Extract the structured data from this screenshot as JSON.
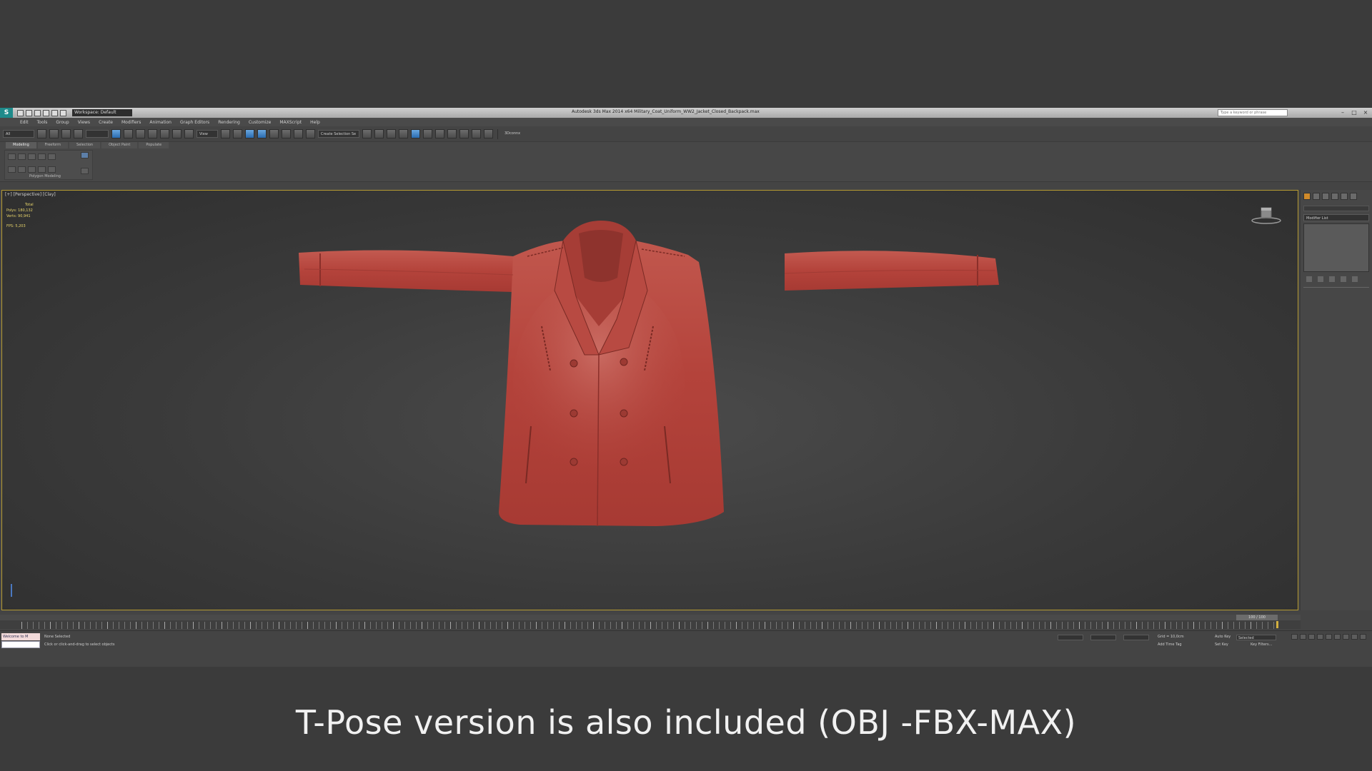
{
  "app": {
    "title": "Autodesk 3ds Max 2014 x64    Military_Coat_Uniform_WW2_Jacket_Closed_Backpack.max",
    "workspace": "Workspace: Default",
    "search_placeholder": "Type a keyword or phrase"
  },
  "menu": [
    "Edit",
    "Tools",
    "Group",
    "Views",
    "Create",
    "Modifiers",
    "Animation",
    "Graph Editors",
    "Rendering",
    "Customize",
    "MAXScript",
    "Help"
  ],
  "toolbar": {
    "selection_filter": "All",
    "view_dd": "View",
    "named_selection": "Create Selection Se",
    "extra_label": "3Dconnx"
  },
  "ribbon": {
    "tabs": [
      "Modeling",
      "Freeform",
      "Selection",
      "Object Paint",
      "Populate"
    ],
    "panel_label": "Polygon Modeling"
  },
  "viewport": {
    "label": "[+] [Perspective] [Clay]",
    "stats_header": "Total",
    "polys_label": "Polys:",
    "polys_value": "180,132",
    "verts_label": "Verts:",
    "verts_value": "90,941",
    "fps_label": "FPS:",
    "fps_value": "5,203",
    "jacket_color": "#b9453e"
  },
  "command_panel": {
    "modifier_list": "Modifier List"
  },
  "timeline": {
    "frame_display": "100 / 100"
  },
  "status": {
    "maxscript": "Welcome to M",
    "maxscript2": "",
    "selection": "None Selected",
    "prompt": "Click or click-and-drag to select objects",
    "grid": "Grid = 10,0cm",
    "add_time_tag": "Add Time Tag",
    "auto_key": "Auto Key",
    "set_key": "Set Key",
    "selected": "Selected",
    "key_filters": "Key Filters..."
  },
  "caption": "T-Pose version is also included (OBJ -FBX-MAX)"
}
